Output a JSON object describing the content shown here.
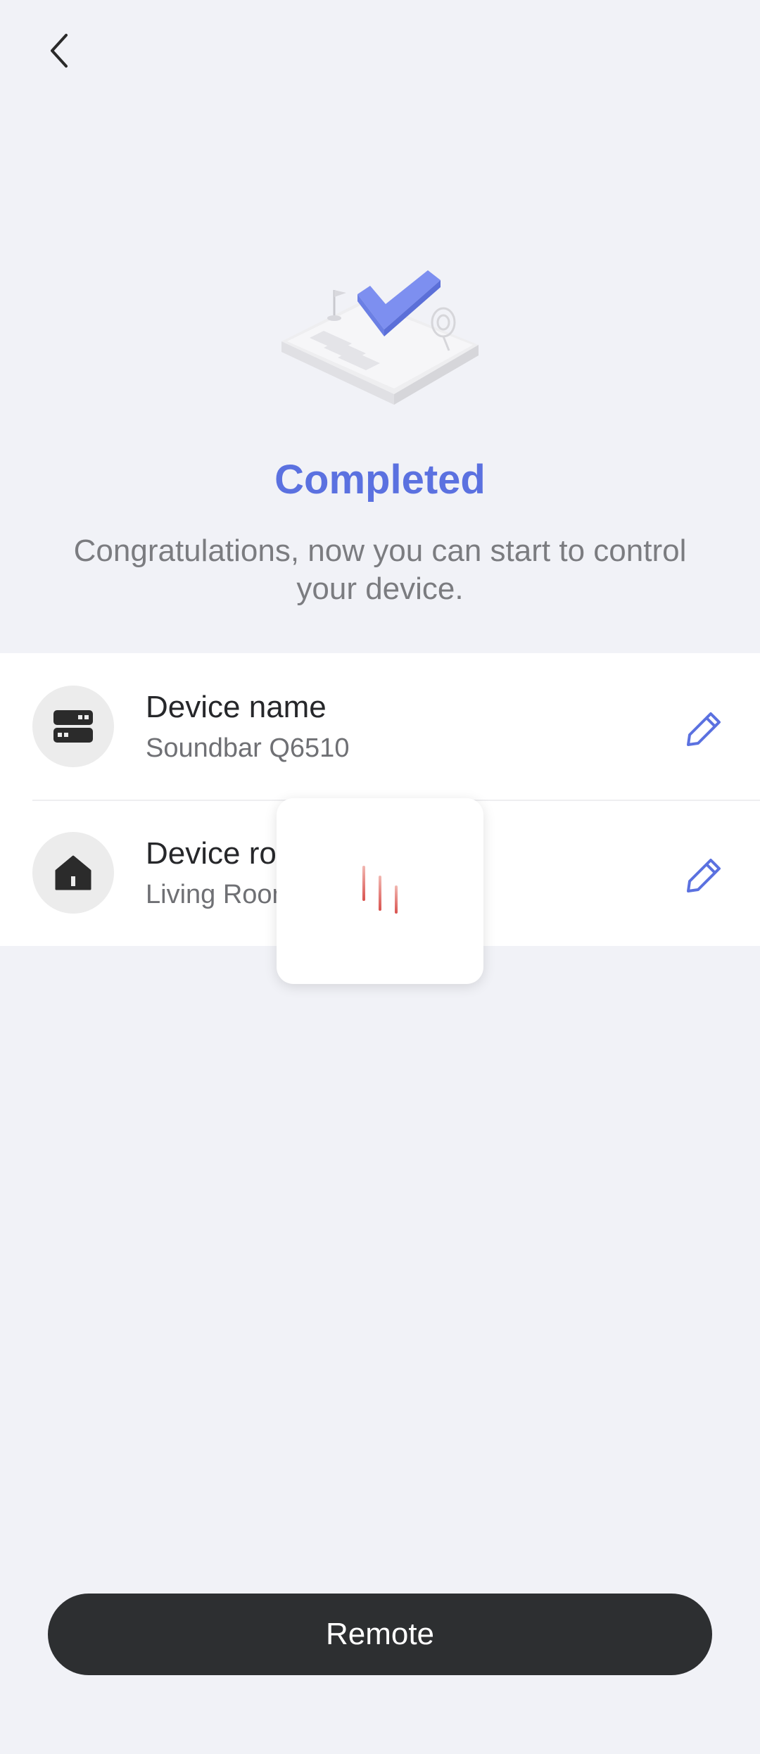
{
  "header": {
    "back_icon": "chevron-left-icon"
  },
  "hero": {
    "illustration": "completed-checklist-illustration",
    "title": "Completed",
    "subtitle": "Congratulations, now you can start to control your device."
  },
  "details": {
    "items": [
      {
        "icon": "device-icon",
        "label": "Device name",
        "value": "Soundbar Q6510",
        "edit_icon": "pencil-icon"
      },
      {
        "icon": "home-icon",
        "label": "Device room",
        "value": "Living Room",
        "edit_icon": "pencil-icon"
      }
    ]
  },
  "loading_overlay": {
    "icon": "loading-bars-icon"
  },
  "footer": {
    "remote_label": "Remote"
  },
  "colors": {
    "accent": "#5b71e0",
    "background": "#f1f2f7",
    "button": "#2d2f31",
    "loader": "#d9534f"
  }
}
